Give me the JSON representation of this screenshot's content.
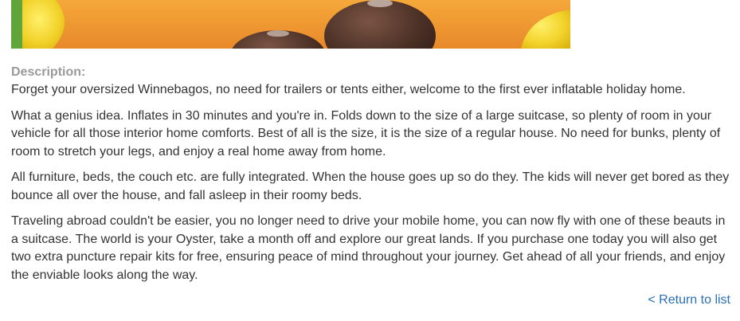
{
  "product": {
    "image": {
      "icon": "inflatable-house-photo",
      "colors": {
        "background": "#f09a2e",
        "yellow": "#f2d22a",
        "green": "#5fa53a",
        "brown": "#5a3a2c",
        "brown_dark": "#3b2620"
      }
    },
    "description_label": "Description:",
    "paragraphs": [
      "Forget your oversized Winnebagos, no need for trailers or tents either, welcome to the first ever inflatable holiday home.",
      "What a genius idea. Inflates in 30 minutes and you're in. Folds down to the size of a large suitcase, so plenty of room in your vehicle for all those interior home comforts. Best of all is the size, it is the size of a regular house. No need for bunks, plenty of room to stretch your legs, and enjoy a real home away from home.",
      "All furniture, beds, the couch etc. are fully integrated. When the house goes up so do they. The kids will never get bored as they bounce all over the house, and fall asleep in their roomy beds.",
      "Traveling abroad couldn't be easier, you no longer need to drive your mobile home, you can now fly with one of these beauts in a suitcase. The world is your Oyster, take a month off and explore our great lands. If you purchase one today you will also get two extra puncture repair kits for free, ensuring peace of mind throughout your journey. Get ahead of all your friends, and enjoy the enviable looks along the way."
    ]
  },
  "navigation": {
    "return_label": "< Return to list",
    "link_color": "#2a6fb5"
  }
}
